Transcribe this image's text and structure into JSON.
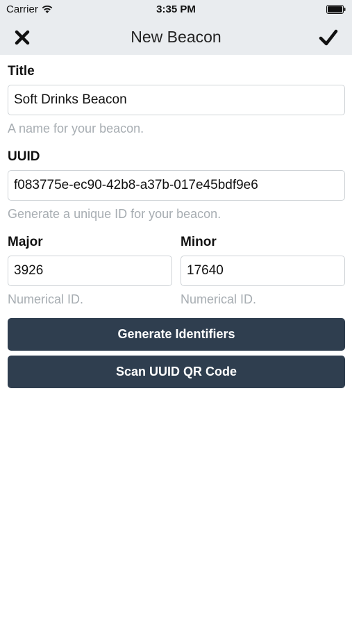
{
  "status_bar": {
    "carrier": "Carrier",
    "time": "3:35 PM"
  },
  "nav": {
    "title": "New Beacon",
    "close_icon": "close-icon",
    "done_icon": "checkmark-icon"
  },
  "form": {
    "title": {
      "label": "Title",
      "value": "Soft Drinks Beacon",
      "hint": "A name for your beacon."
    },
    "uuid": {
      "label": "UUID",
      "value": "f083775e-ec90-42b8-a37b-017e45bdf9e6",
      "hint": "Generate a unique ID for your beacon."
    },
    "major": {
      "label": "Major",
      "value": "3926",
      "hint": "Numerical ID."
    },
    "minor": {
      "label": "Minor",
      "value": "17640",
      "hint": "Numerical ID."
    }
  },
  "buttons": {
    "generate": "Generate Identifiers",
    "scan": "Scan UUID QR Code"
  },
  "colors": {
    "header_bg": "#e9ecef",
    "button_bg": "#2f3e4f",
    "hint_text": "#a7adb2"
  }
}
